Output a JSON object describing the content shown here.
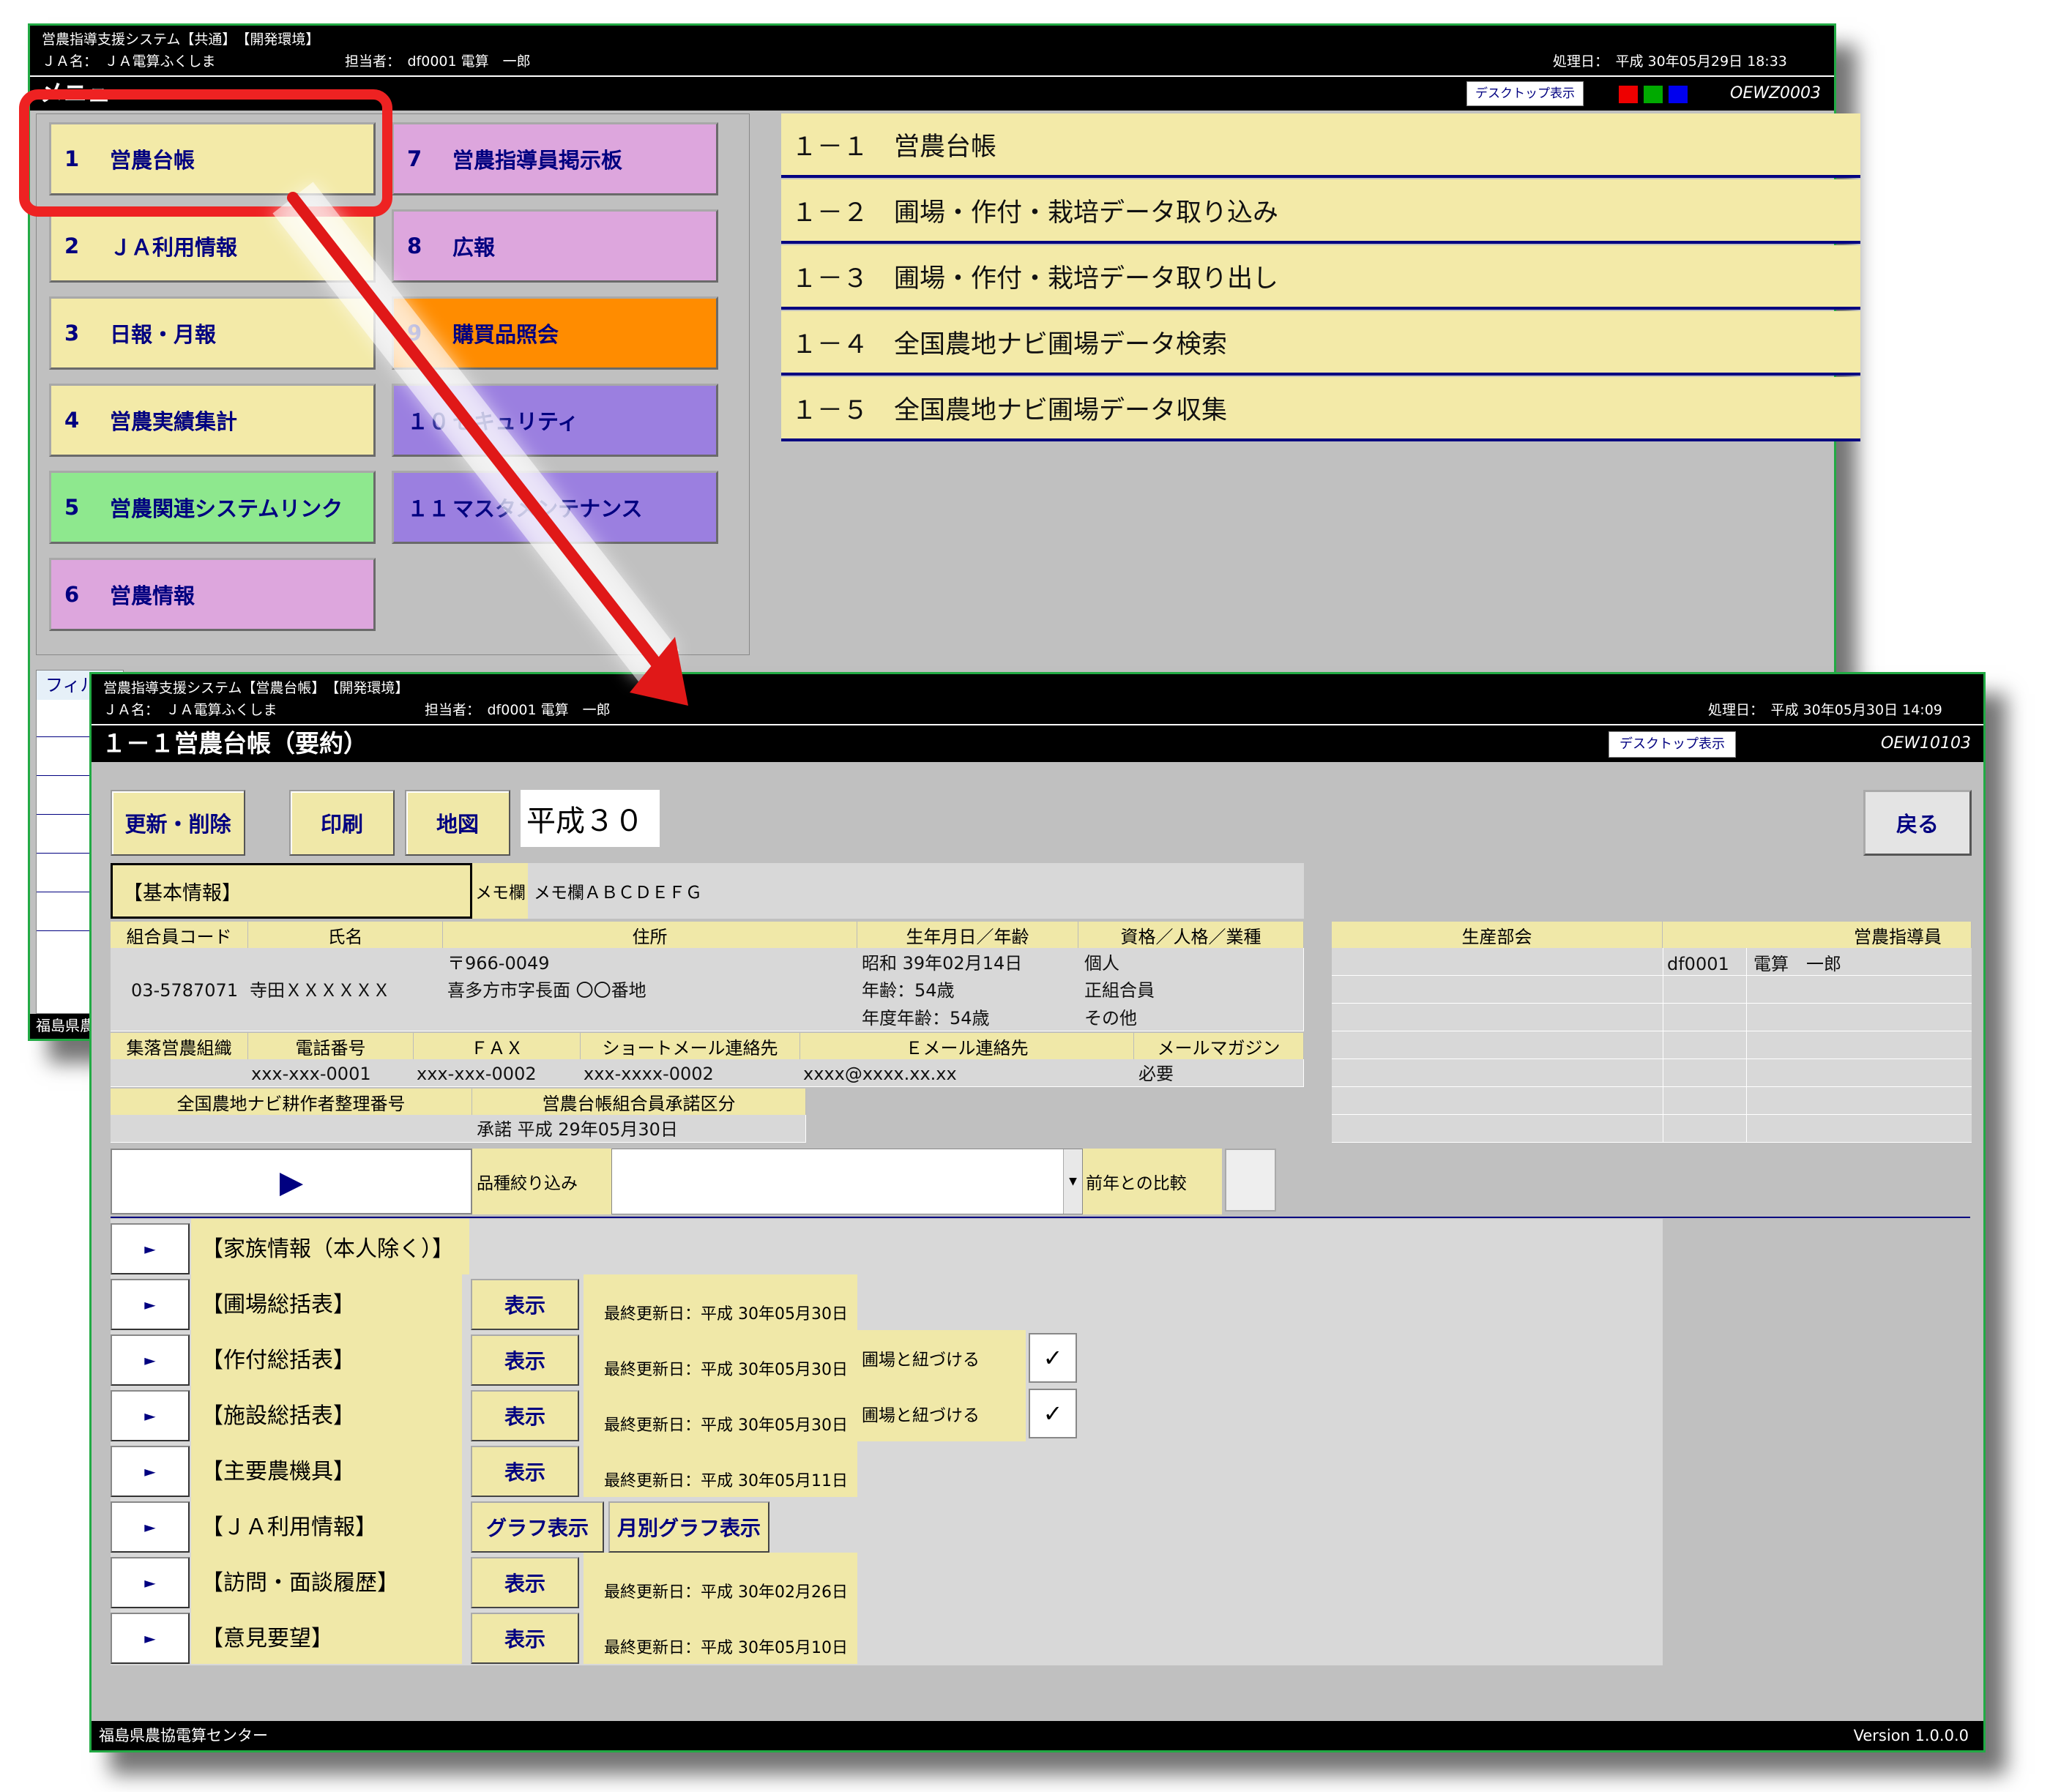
{
  "back": {
    "title": "営農指導支援システム【共通】　【開発環境】",
    "ja": "ＪＡ名：　ＪＡ電算ふくしま",
    "user": "担当者：　df0001 電算　一郎",
    "date": "処理日：　平成 30年05月29日 18:33",
    "heading": "メニュー",
    "desktop": "デスクトップ表示",
    "code": "OEWZ0003",
    "menu": [
      {
        "num": "1",
        "label": "営農台帳"
      },
      {
        "num": "2",
        "label": "ＪＡ利用情報"
      },
      {
        "num": "3",
        "label": "日報・月報"
      },
      {
        "num": "4",
        "label": "営農実績集計"
      },
      {
        "num": "5",
        "label": "営農関連システムリンク"
      },
      {
        "num": "6",
        "label": "営農情報"
      },
      {
        "num": "7",
        "label": "営農指導員掲示板"
      },
      {
        "num": "8",
        "label": "広報"
      },
      {
        "num": "9",
        "label": "購買品照会"
      },
      {
        "num": "１０",
        "label": "セキュリティ"
      },
      {
        "num": "１１",
        "label": "マスタメンテナンス"
      }
    ],
    "submenu": [
      "１－１　営農台帳",
      "１－２　圃場・作付・栽培データ取り込み",
      "１－３　圃場・作付・栽培データ取り出し",
      "１－４　全国農地ナビ圃場データ検索",
      "１－５　全国農地ナビ圃場データ収集"
    ],
    "filter": "フィル",
    "footer": "福島県農"
  },
  "front": {
    "title": "営農指導支援システム【営農台帳】　【開発環境】",
    "ja": "ＪＡ名：　ＪＡ電算ふくしま",
    "user": "担当者：　df0001 電算　一郎",
    "date": "処理日：　平成 30年05月30日 14:09",
    "heading": "１－１営農台帳（要約）",
    "desktop": "デスクトップ表示",
    "code": "OEW10103",
    "buttons": {
      "update": "更新・削除",
      "print": "印刷",
      "map": "地図",
      "back": "戻る"
    },
    "year": "平成３０",
    "basic": "【基本情報】",
    "memo_label": "メモ欄",
    "memo_value": "メモ欄ＡＢＣＤＥＦＧ",
    "h1": [
      "組合員コード",
      "氏名",
      "住所",
      "生年月日／年齢",
      "資格／人格／業種"
    ],
    "member_code": "03-5787071",
    "member_name": "寺田ＸＸＸＸＸＸ",
    "postal": "〒966-0049",
    "address": "喜多方市字長面 〇〇番地",
    "birth": "昭和 39年02月14日",
    "age": "年齢：54歳",
    "fy_age": "年度年齢：54歳",
    "q1": "個人",
    "q2": "正組合員",
    "q3": "その他",
    "h2": [
      "集落営農組織",
      "電話番号",
      "ＦＡＸ",
      "ショートメール連絡先",
      "Ｅメール連絡先",
      "メールマガジン"
    ],
    "phone": "xxx-xxx-0001",
    "fax": "xxx-xxx-0002",
    "sms": "xxx-xxxx-0002",
    "email": "xxxx@xxxx.xx.xx",
    "magazine": "必要",
    "h3": [
      "全国農地ナビ耕作者整理番号",
      "営農台帳組合員承諾区分"
    ],
    "consent": "承諾 平成 29年05月30日",
    "right_h": [
      "生産部会",
      "営農指導員"
    ],
    "instructor_id": "df0001",
    "instructor_name": "電算　一郎",
    "play": "▶",
    "variety_label": "品種絞り込み",
    "compare_label": "前年との比較",
    "sections": [
      {
        "label": "【家族情報（本人除く）】"
      },
      {
        "label": "【圃場総括表】",
        "btn": "表示",
        "updated": "最終更新日：平成 30年05月30日"
      },
      {
        "label": "【作付総括表】",
        "btn": "表示",
        "updated": "最終更新日：平成 30年05月30日",
        "link": "圃場と紐づける",
        "check": "✓"
      },
      {
        "label": "【施設総括表】",
        "btn": "表示",
        "updated": "最終更新日：平成 30年05月30日",
        "link": "圃場と紐づける",
        "check": "✓"
      },
      {
        "label": "【主要農機具】",
        "btn": "表示",
        "updated": "最終更新日：平成 30年05月11日"
      },
      {
        "label": "【ＪＡ利用情報】",
        "btn": "グラフ表示",
        "btn2": "月別グラフ表示"
      },
      {
        "label": "【訪問・面談履歴】",
        "btn": "表示",
        "updated": "最終更新日：平成 30年02月26日"
      },
      {
        "label": "【意見要望】",
        "btn": "表示",
        "updated": "最終更新日：平成 30年05月10日"
      }
    ],
    "arrow": "►",
    "footer": "福島県農協電算センター",
    "version": "Version 1.0.0.0"
  },
  "colors": {
    "highlight": "#ee2222",
    "menu_yellow": "#f3eaa8",
    "menu_pink": "#dda6dd",
    "menu_orange": "#ff8c00",
    "menu_purple": "#9b7fe0",
    "menu_green": "#8ee88e"
  }
}
